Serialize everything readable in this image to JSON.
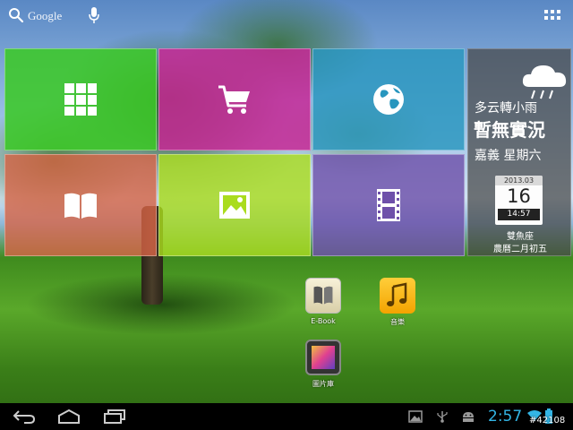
{
  "search_bar": {
    "label": "Google"
  },
  "tiles": [
    {
      "name": "tile-apps-grid",
      "icon": "grid-icon",
      "color": "#3cc828"
    },
    {
      "name": "tile-shopping",
      "icon": "shopping-cart-icon",
      "color": "#c82896"
    },
    {
      "name": "tile-browser",
      "icon": "globe-icon",
      "color": "#2896be"
    },
    {
      "name": "tile-ebook",
      "icon": "open-book-icon",
      "color": "#d76446"
    },
    {
      "name": "tile-gallery",
      "icon": "picture-icon",
      "color": "#aadc1e"
    },
    {
      "name": "tile-video",
      "icon": "film-strip-icon",
      "color": "#6e50aa"
    }
  ],
  "widget": {
    "weather_desc": "多云轉小雨",
    "weather_status": "暫無實況",
    "city_day": "嘉義 星期六",
    "calendar": {
      "month": "2013.03",
      "day": "16",
      "time": "14:57"
    },
    "zodiac": "雙魚座",
    "lunar_date": "農曆二月初五"
  },
  "shortcuts": [
    {
      "label": "E-Book",
      "icon": "ebook-icon"
    },
    {
      "label": "音樂",
      "icon": "music-note-icon"
    },
    {
      "label": "圖片庫",
      "icon": "gallery-icon"
    }
  ],
  "status_bar": {
    "time": "2:57",
    "accent_color": "#33b5e5"
  },
  "watermark": "#42108"
}
